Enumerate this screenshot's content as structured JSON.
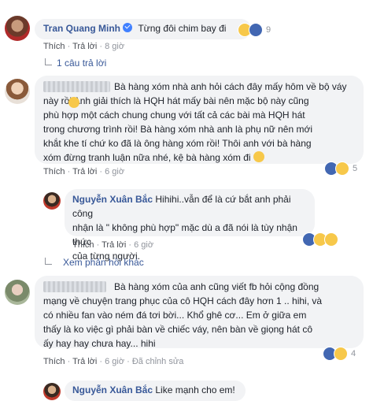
{
  "c1": {
    "author": "Tran Quang Minh",
    "text": "Từng đôi chim bay đi",
    "like": "Thích",
    "reply": "Trả lời",
    "time": "8 giờ",
    "reaction_count": "9",
    "replies_link": "1 câu trả lời"
  },
  "c2": {
    "lines": [
      "Bà hàng xóm nhà anh hỏi cách đây mấy hôm về bộ váy",
      "này rồi  Anh giải thích là HQH hát mấy bài nên mặc bộ này cũng",
      "phù hợp một cách chung chung với tất cả các bài mà HQH hát",
      "trong chương trình rồi! Bà hàng xóm nhà anh là phụ nữ nên mới",
      "khắt khe tí chứ ko đã là ông hàng xóm rồi! Thôi anh với bà hàng",
      "xóm đừng tranh luận nữa nhé, kệ bà hàng xóm đi"
    ],
    "like": "Thích",
    "reply": "Trả lời",
    "time": "6 giờ",
    "reaction_count": "5"
  },
  "c3": {
    "author": "Nguyễn Xuân Bắc",
    "lines": [
      "Hihihi..vẫn để là cứ bắt anh phải công",
      "nhận là \" không phù hợp\" mặc dù a đã nói là tùy nhận thức",
      "của từng người."
    ],
    "like": "Thích",
    "reply": "Trả lời",
    "time": "6 giờ"
  },
  "more_replies": "Xem phản hồi khác",
  "c4": {
    "lines": [
      "Bà hàng xóm của anh cũng viết fb hỏi cộng đồng",
      "mạng về chuyện trang phục của cô HQH cách đây hơn 1 .. hihi, và",
      "có nhiều fan vào ném đá tơi bời... Khổ ghê cơ... Em ở giữa em",
      "thấy là ko việc gì phải bàn về chiếc váy, nên bàn về giọng hát cô",
      "ấy hay hay chưa hay... hihi"
    ],
    "like": "Thích",
    "reply": "Trả lời",
    "time": "6 giờ",
    "edited": "Đã chỉnh sửa",
    "reaction_count": "4"
  },
  "c5": {
    "author": "Nguyễn Xuân Bắc",
    "text": "Like mạnh cho em!"
  },
  "colors": {
    "link": "#385898",
    "bubble": "#f2f3f5",
    "meta": "#90949c",
    "like": "#4267b2",
    "emoji": "#f7c84a"
  }
}
